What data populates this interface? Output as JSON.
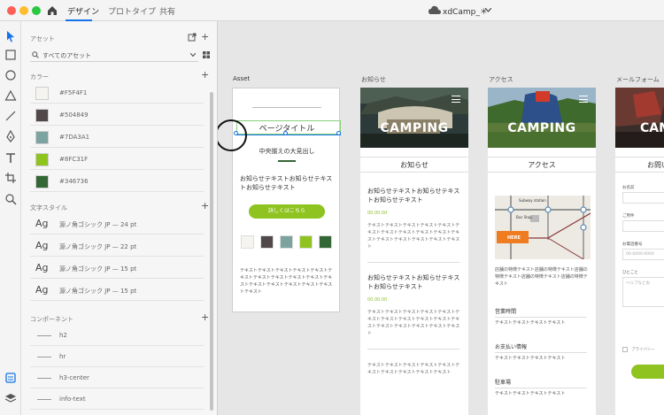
{
  "titlebar": {
    "tabs": [
      "デザイン",
      "プロトタイプ",
      "共有"
    ],
    "active_tab": 0,
    "document_name": "xdCamp_＊",
    "colors": {
      "close": "#fe5f57",
      "minimize": "#febc2e",
      "zoom": "#28c840",
      "accent": "#1473e6"
    }
  },
  "tools": [
    "select-icon",
    "rectangle-icon",
    "ellipse-icon",
    "triangle-icon",
    "line-icon",
    "pen-icon",
    "text-icon",
    "artboard-icon",
    "zoom-icon",
    "assets-icon",
    "layers-icon"
  ],
  "assets_panel": {
    "title": "アセット",
    "search_placeholder": "すべてのアセット",
    "colors_title": "カラー",
    "colors": [
      {
        "hex": "#F5F4F1",
        "label": "#F5F4F1"
      },
      {
        "hex": "#504849",
        "label": "#504849"
      },
      {
        "hex": "#7DA3A1",
        "label": "#7DA3A1"
      },
      {
        "hex": "#8FC31F",
        "label": "#8FC31F"
      },
      {
        "hex": "#346736",
        "label": "#346736"
      }
    ],
    "char_styles_title": "文字スタイル",
    "char_styles": [
      {
        "glyph": "Ag",
        "label": "源ノ角ゴシック JP — 24 pt"
      },
      {
        "glyph": "Ag",
        "label": "源ノ角ゴシック JP — 22 pt"
      },
      {
        "glyph": "Ag",
        "label": "源ノ角ゴシック JP — 15 pt"
      },
      {
        "glyph": "Ag",
        "label": "源ノ角ゴシック JP — 15 pt"
      }
    ],
    "components_title": "コンポーネント",
    "components": [
      "h2",
      "hr",
      "h3-center",
      "info-text"
    ]
  },
  "artboards": {
    "asset": {
      "label": "Asset",
      "page_title": "ページタイトル",
      "subheading": "中央揃えの大見出し",
      "news_text": "お知らせテキストお知らせテキストお知らせテキスト",
      "button": "詳しくはこちら",
      "body_text": "テキストテキストテキストテキストテキストテキストテキストテキストテキストテキストテキストテキストテキストテキストテキストテキストテキスト"
    },
    "news": {
      "label": "お知らせ",
      "hero": "CAMPING",
      "section_title": "お知らせ",
      "items": [
        {
          "title": "お知らせテキストお知らせテキストお知らせテキスト",
          "date": "00.00.00",
          "body": "テキストテキストテキストテキストテキストテキストテキストテキストテキストテキストテキストテキストテキストテキストテキストテキスト"
        },
        {
          "title": "お知らせテキストお知らせテキストお知らせテキスト",
          "date": "00.00.00",
          "body": "テキストテキストテキストテキストテキストテキストテキストテキストテキストテキストテキストテキストテキストテキストテキストテキスト"
        },
        {
          "title": "",
          "date": "",
          "body": "テキストテキストテキストテキストテキストテキストテキストテキストテキストテキスト"
        }
      ]
    },
    "access": {
      "label": "アクセス",
      "hero": "CAMPING",
      "section_title": "アクセス",
      "map_labels": [
        "Subway station",
        "Bus Stop",
        "HERE"
      ],
      "description": "店舗の特徴テキスト店舗の特徴テキスト店舗の特徴テキスト店舗の特徴テキスト店舗の特徴テキスト",
      "sections": [
        {
          "title": "営業時間",
          "text": "テキストテキストテキストテキスト"
        },
        {
          "title": "お支払い情報",
          "text": "テキストテキストテキストテキスト"
        },
        {
          "title": "駐車場",
          "text": "テキストテキストテキストテキスト"
        }
      ]
    },
    "mail": {
      "label": "メールフォーム",
      "hero": "CAM",
      "section_title": "お問い",
      "fields": [
        {
          "label": "お名前",
          "placeholder": ""
        },
        {
          "label": "ご用件",
          "placeholder": ""
        },
        {
          "label": "お電話番号",
          "placeholder": "00-0000-0000"
        },
        {
          "label": "ひとこと",
          "placeholder": "ヘルプなどお"
        }
      ],
      "checkbox_label": "プライバシー"
    }
  }
}
